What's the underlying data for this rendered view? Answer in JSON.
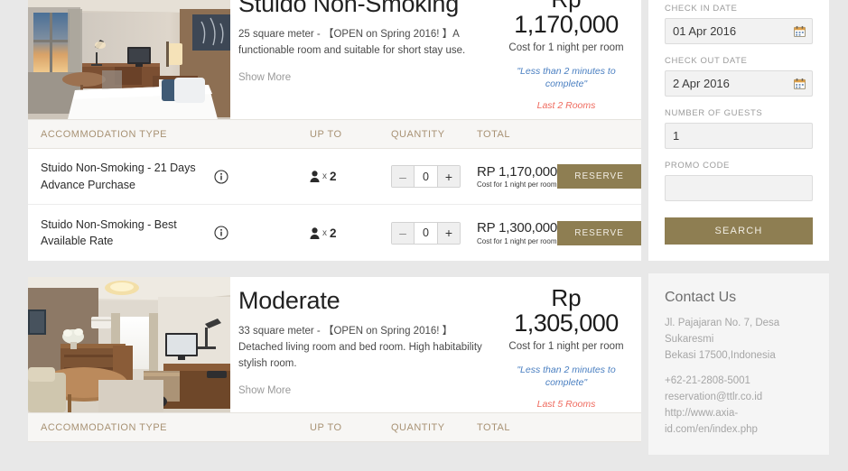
{
  "rooms": [
    {
      "title": "Stuido Non-Smoking",
      "description": "25 square meter - 【OPEN on Spring 2016! 】A functionable room and suitable for short stay use.",
      "show_more": "Show More",
      "currency": "Rp",
      "price": "1,170,000",
      "price_note": "Cost for 1 night per room",
      "minutes_note": "\"Less than 2 minutes to complete\"",
      "rooms_left": "Last 2 Rooms",
      "photo_alt": "studio-non-smoking-room-photo",
      "table": {
        "headers": {
          "type": "ACCOMMODATION TYPE",
          "upto": "UP TO",
          "quantity": "QUANTITY",
          "total": "TOTAL"
        },
        "rows": [
          {
            "name": "Stuido Non-Smoking - 21 Days Advance Purchase",
            "info_icon": "info-circle-icon",
            "upto_icon": "person-icon",
            "upto_x": "x",
            "upto_count": "2",
            "minus": "–",
            "quantity": "0",
            "plus": "+",
            "total": "RP 1,170,000",
            "total_sub": "Cost for 1 night per room",
            "reserve": "RESERVE"
          },
          {
            "name": "Stuido Non-Smoking - Best Available Rate",
            "info_icon": "info-circle-icon",
            "upto_icon": "person-icon",
            "upto_x": "x",
            "upto_count": "2",
            "minus": "–",
            "quantity": "0",
            "plus": "+",
            "total": "RP 1,300,000",
            "total_sub": "Cost for 1 night per room",
            "reserve": "RESERVE"
          }
        ]
      }
    },
    {
      "title": "Moderate",
      "description": "33 square meter - 【OPEN on Spring 2016! 】Detached living room and bed room. High habitability stylish room.",
      "show_more": "Show More",
      "currency": "Rp",
      "price": "1,305,000",
      "price_note": "Cost for 1 night per room",
      "minutes_note": "\"Less than 2 minutes to complete\"",
      "rooms_left": "Last 5 Rooms",
      "photo_alt": "moderate-room-photo",
      "table": {
        "headers": {
          "type": "ACCOMMODATION TYPE",
          "upto": "UP TO",
          "quantity": "QUANTITY",
          "total": "TOTAL"
        },
        "rows": []
      }
    }
  ],
  "sidebar": {
    "search_form": {
      "checkin_label": "CHECK IN DATE",
      "checkin_value": "01 Apr 2016",
      "checkin_icon": "calendar-icon",
      "checkout_label": "CHECK OUT DATE",
      "checkout_value": "2 Apr 2016",
      "checkout_icon": "calendar-icon",
      "guests_label": "NUMBER OF GUESTS",
      "guests_value": "1",
      "promo_label": "PROMO CODE",
      "promo_value": "",
      "promo_placeholder": "",
      "search_button": "SEARCH"
    },
    "contact": {
      "title": "Contact Us",
      "address_line1": "Jl. Pajajaran No. 7, Desa Sukaresmi",
      "address_line2": "Bekasi 17500,Indonesia",
      "phone": "+62-21-2808-5001",
      "email": "reservation@ttlr.co.id",
      "website": "http://www.axia-id.com/en/index.php"
    }
  },
  "colors": {
    "accent_gold": "#8e7e52",
    "header_text": "#a89274",
    "blue_note": "#4a7fc1",
    "red_note": "#ef6a5e",
    "page_bg": "#e8e8e8"
  }
}
